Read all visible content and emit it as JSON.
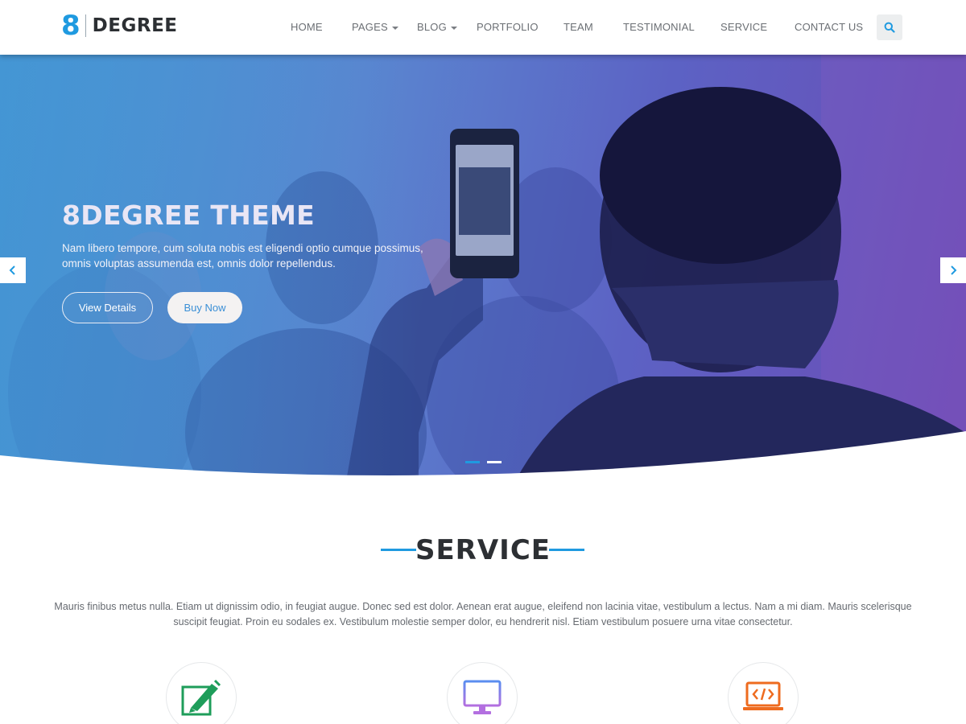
{
  "logo": {
    "mark": "8",
    "text": "DEGREE"
  },
  "nav": {
    "items": [
      {
        "label": "HOME",
        "dropdown": false
      },
      {
        "label": "PAGES",
        "dropdown": true
      },
      {
        "label": "BLOG",
        "dropdown": true
      },
      {
        "label": "PORTFOLIO",
        "dropdown": false
      },
      {
        "label": "TEAM",
        "dropdown": false
      },
      {
        "label": "TESTIMONIAL",
        "dropdown": false
      },
      {
        "label": "SERVICE",
        "dropdown": false
      },
      {
        "label": "CONTACT US",
        "dropdown": false
      }
    ],
    "search_icon": "search-icon"
  },
  "hero": {
    "title": "8DEGREE THEME",
    "description": "Nam libero tempore, cum soluta nobis est eligendi optio cumque possimus, omnis voluptas assumenda est, omnis dolor repellendus.",
    "btn_details": "View Details",
    "btn_buy": "Buy Now",
    "slides_total": 2,
    "active_slide": 1
  },
  "service": {
    "title": "SERVICE",
    "description": "Mauris finibus metus nulla. Etiam ut dignissim odio, in feugiat augue. Donec sed est dolor. Aenean erat augue, eleifend non lacinia vitae, vestibulum a lectus. Nam a mi diam. Mauris scelerisque suscipit feugiat. Proin eu sodales ex. Vestibulum molestie semper dolor, eu hendrerit nisl. Etiam vestibulum posuere urna vitae consectetur.",
    "icons": [
      {
        "name": "design-pencil-icon",
        "color": "#1e9d5a"
      },
      {
        "name": "monitor-icon",
        "color": "#a57ee8"
      },
      {
        "name": "code-laptop-icon",
        "color": "#ee6b1f"
      }
    ]
  },
  "colors": {
    "accent": "#1f9ae0",
    "hero_gradient_start": "#4a9ed8",
    "hero_gradient_end": "#6d4bb5"
  }
}
